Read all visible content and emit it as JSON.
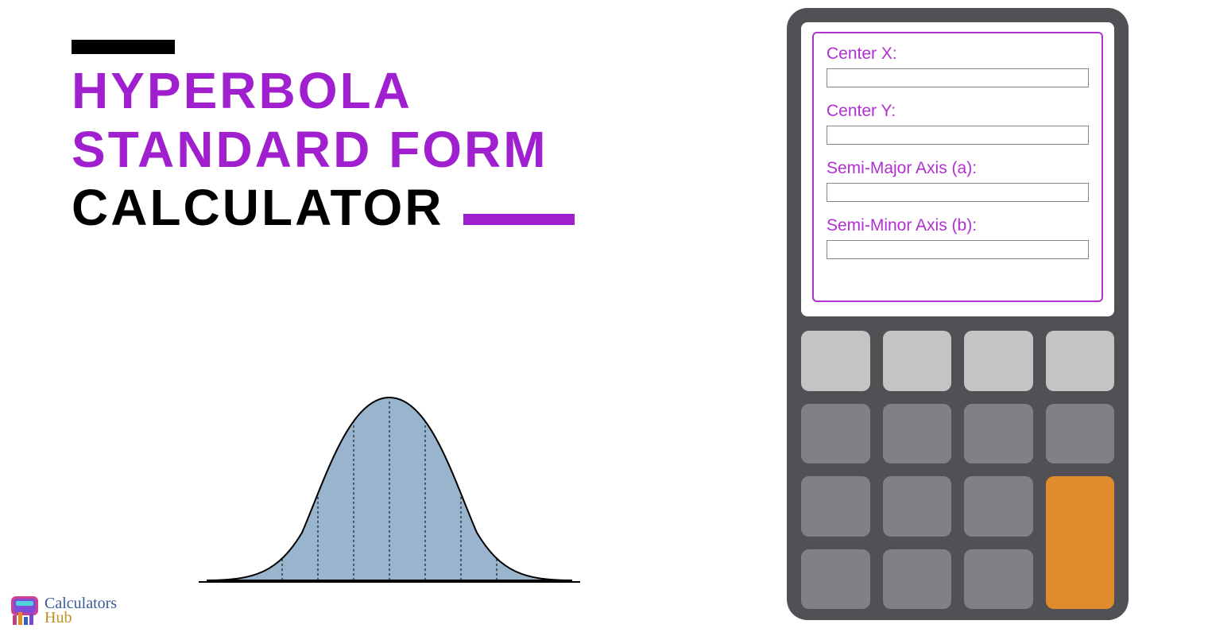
{
  "title": {
    "line1": "HYPERBOLA",
    "line2": "STANDARD FORM",
    "line3": "CALCULATOR"
  },
  "form": {
    "fields": [
      {
        "label": "Center X:",
        "value": ""
      },
      {
        "label": "Center Y:",
        "value": ""
      },
      {
        "label": "Semi-Major Axis (a):",
        "value": ""
      },
      {
        "label": "Semi-Minor Axis (b):",
        "value": ""
      }
    ]
  },
  "logo": {
    "line1": "Calculators",
    "line2": "Hub"
  }
}
